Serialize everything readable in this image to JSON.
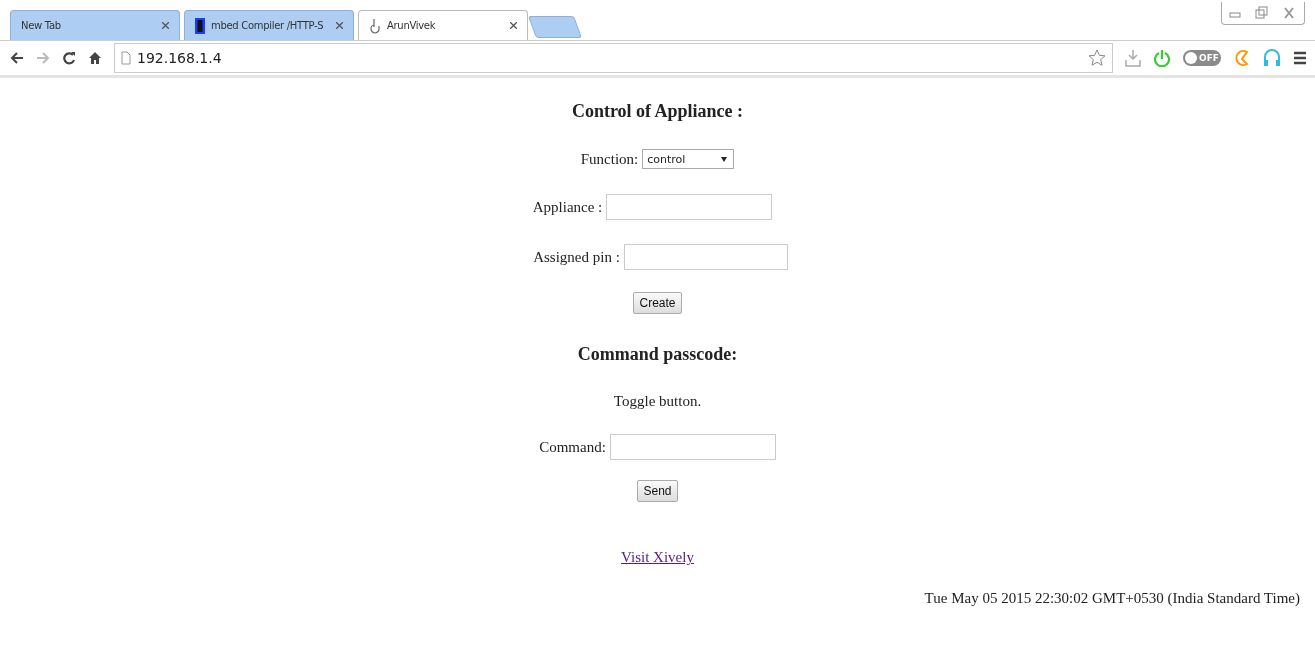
{
  "browser": {
    "tabs": [
      {
        "title": "New Tab",
        "kind": "plain",
        "selected": false
      },
      {
        "title": "mbed Compiler /HTTP-S",
        "kind": "chip",
        "selected": false
      },
      {
        "title": "ArunVivek",
        "kind": "hand",
        "selected": true
      }
    ],
    "address": "192.168.1.4",
    "toggle_label": "OFF",
    "toggle_on": false
  },
  "page": {
    "heading": "Control of Appliance :",
    "function": {
      "label": "Function:",
      "value": "control"
    },
    "appliance": {
      "label": "Appliance :"
    },
    "pin": {
      "label": "Assigned pin :"
    },
    "create_button": "Create",
    "heading2": "Command passcode:",
    "toggle_text": "Toggle button.",
    "command": {
      "label": "Command:"
    },
    "send_button": "Send",
    "link": "Visit Xively",
    "timestamp": "Tue May 05 2015 22:30:02 GMT+0530 (India Standard Time)"
  }
}
